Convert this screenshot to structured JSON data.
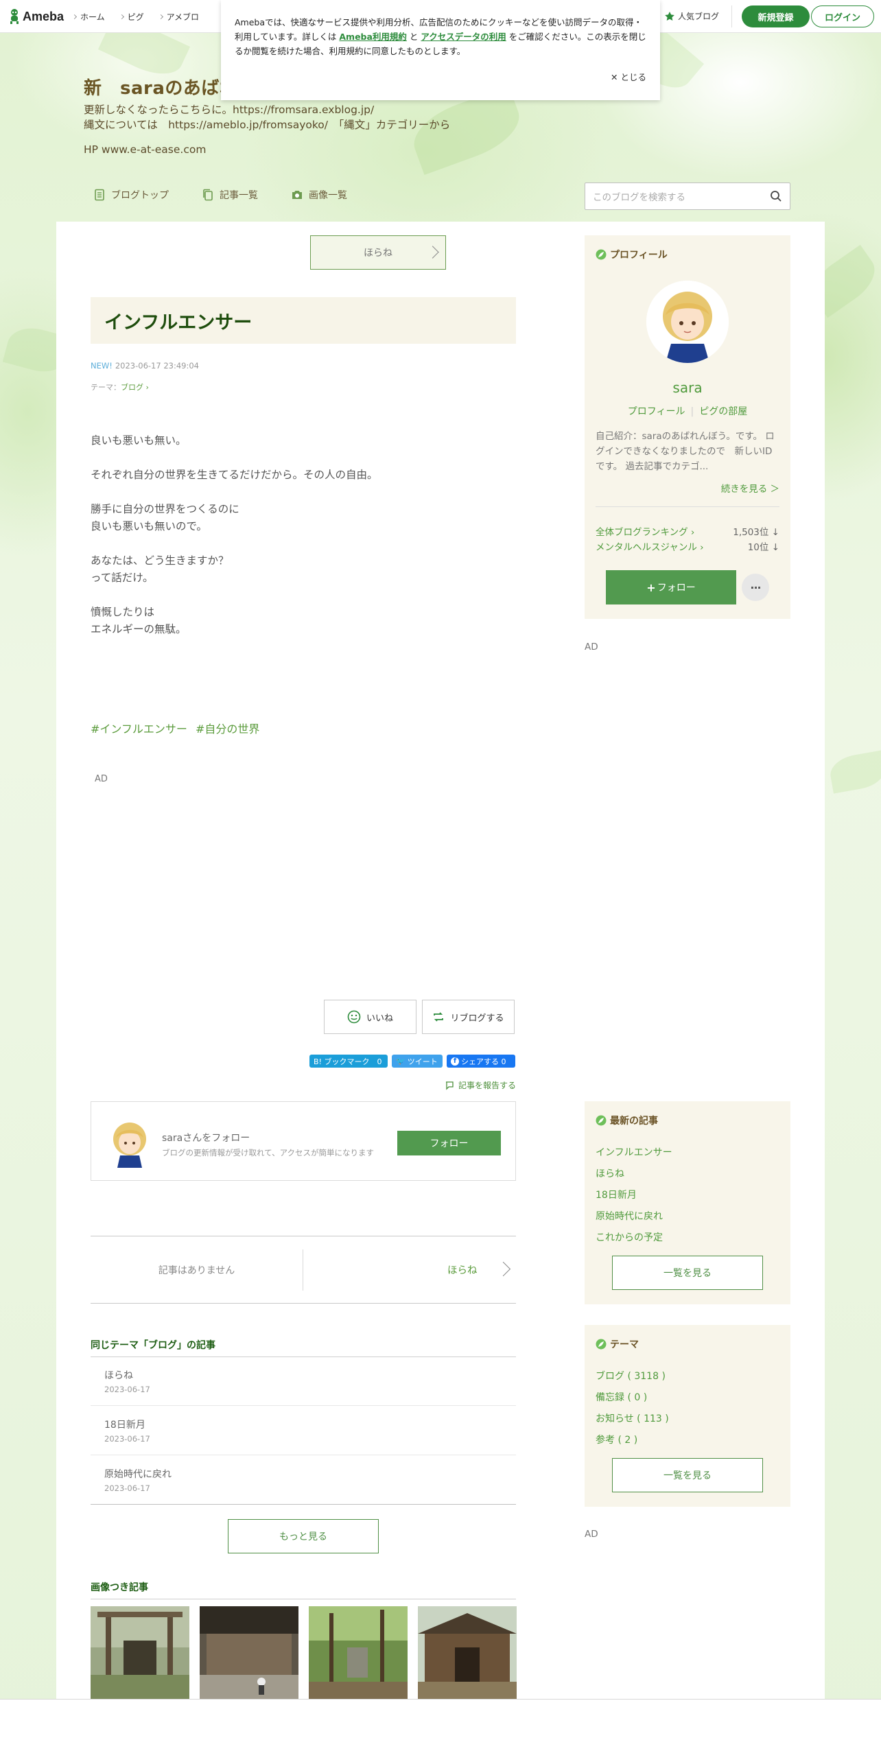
{
  "global_header": {
    "logo": "Ameba",
    "nav": [
      "ホーム",
      "ピグ",
      "アメブロ"
    ],
    "popular_blog": "人気ブログ",
    "register": "新規登録",
    "login": "ログイン"
  },
  "cookie": {
    "text_before": "Amebaでは、快適なサービス提供や利用分析、広告配信のためにクッキーなどを使い訪問データの取得・利用しています。詳しくは",
    "link1": "Ameba利用規約",
    "and": "と",
    "link2": "アクセスデータの利用",
    "text_after": "をご確認ください。この表示を閉じるか閲覧を続けた場合、利用規約に同意したものとします。",
    "close": "とじる"
  },
  "blog": {
    "title": "新　saraのあばれ",
    "desc1": "更新しなくなったらこちらに。https://fromsara.exblog.jp/",
    "desc2": "縄文については　https://ameblo.jp/fromsayoko/　「縄文」カテゴリーから",
    "hp": "HP www.e-at-ease.com",
    "nav": {
      "top": "ブログトップ",
      "list": "記事一覧",
      "images": "画像一覧"
    },
    "search_placeholder": "このブログを検索する"
  },
  "article": {
    "prev_top": "ほらね",
    "title": "インフルエンサー",
    "new": "NEW!",
    "date": "2023-06-17 23:49:04",
    "theme_label": "テーマ：",
    "theme": "ブログ",
    "body": "良いも悪いも無い。\n\nそれぞれ自分の世界を生きてるだけだから。その人の自由。\n\n勝手に自分の世界をつくるのに\n良いも悪いも無いので。\n\nあなたは、どう生きますか？\nって話だけ。\n\n憤慨したりは\nエネルギーの無駄。",
    "tags": [
      "#インフルエンサー",
      "#自分の世界"
    ],
    "ad": "AD",
    "like": "いいね",
    "reblog": "リブログする",
    "share": {
      "hatena": "B! ブックマーク　0",
      "tweet": "ツイート",
      "facebook": "シェアする 0"
    },
    "report": "記事を報告する",
    "follow_box": {
      "name": "saraさんをフォロー",
      "desc": "ブログの更新情報が受け取れて、アクセスが簡単になります",
      "button": "フォロー"
    },
    "nav_prev": "記事はありません",
    "nav_next": "ほらね"
  },
  "related": {
    "heading": "同じテーマ「ブログ」の記事",
    "items": [
      {
        "title": "ほらね",
        "date": "2023-06-17"
      },
      {
        "title": "18日新月",
        "date": "2023-06-17"
      },
      {
        "title": "原始時代に戻れ",
        "date": "2023-06-17"
      }
    ],
    "more": "もっと見る"
  },
  "images_section": {
    "heading": "画像つき記事"
  },
  "sidebar": {
    "profile": {
      "heading": "プロフィール",
      "name": "sara",
      "link1": "プロフィール",
      "link2": "ピグの部屋",
      "intro": "自己紹介：saraのあばれんぼう。です。 ログインできなくなりましたので　新しいIDです。 過去記事でカテゴ...",
      "continue": "続きを見る ＞",
      "rank1_label": "全体ブログランキング",
      "rank1_value": "1,503位 ↓",
      "rank2_label": "メンタルヘルスジャンル",
      "rank2_value": "10位 ↓",
      "follow": "フォロー",
      "plus": "+"
    },
    "ad": "AD",
    "recent": {
      "heading": "最新の記事",
      "items": [
        "インフルエンサー",
        "ほらね",
        "18日新月",
        "原始時代に戻れ",
        "これからの予定"
      ],
      "all": "一覧を見る"
    },
    "themes": {
      "heading": "テーマ",
      "items": [
        "ブログ ( 3118 )",
        "備忘録 ( 0 )",
        "お知らせ ( 113 )",
        "参考 ( 2 )"
      ],
      "all": "一覧を見る"
    },
    "ad2": "AD"
  }
}
